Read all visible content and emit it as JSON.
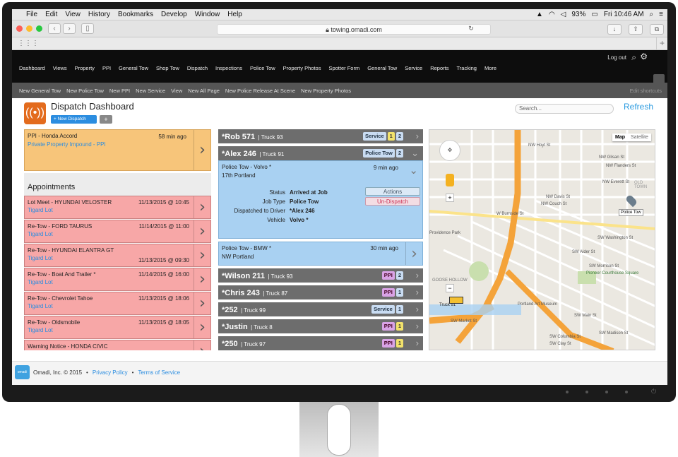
{
  "menubar": {
    "apple": "",
    "items": [
      "File",
      "Edit",
      "View",
      "History",
      "Bookmarks",
      "Develop",
      "Window",
      "Help"
    ],
    "battery": "93%",
    "clock": "Fri 10:46 AM"
  },
  "browser": {
    "url": "towing.omadi.com"
  },
  "topnav": {
    "logout": "Log out",
    "items": [
      "Dashboard",
      "Views",
      "Property",
      "PPI",
      "General Tow",
      "Shop Tow",
      "Dispatch",
      "Inspections",
      "Police Tow",
      "Property Photos",
      "Spotter Form",
      "General Tow",
      "Service",
      "Reports",
      "Tracking",
      "More"
    ]
  },
  "subnav": {
    "items": [
      "New General Tow",
      "New Police Tow",
      "New PPI",
      "New Service",
      "View",
      "New All Page",
      "New Police Release At Scene",
      "New Property Photos"
    ],
    "edit": "Edit shortcuts"
  },
  "header": {
    "title": "Dispatch Dashboard",
    "new_dispatch": "+ New Dispatch",
    "plus": "+",
    "search_placeholder": "Search...",
    "refresh": "Refresh"
  },
  "ppi_card": {
    "title": "PPI - Honda Accord",
    "time": "58 min ago",
    "subtitle": "Private Property Impound - PPI"
  },
  "appointments": {
    "heading": "Appointments",
    "items": [
      {
        "title": "Lot Meet - HYUNDAI VELOSTER",
        "date": "11/13/2015 @ 10:45",
        "location": "Tigard Lot"
      },
      {
        "title": "Re-Tow - FORD TAURUS",
        "date": "11/14/2015 @ 11:00",
        "location": "Tigard Lot"
      },
      {
        "title": "Re-Tow - HYUNDAI ELANTRA GT",
        "date": "11/13/2015 @ 09:30",
        "location": "Tigard Lot"
      },
      {
        "title": "Re-Tow - Boat And Trailer *",
        "date": "11/14/2015 @ 16:00",
        "location": "Tigard Lot"
      },
      {
        "title": "Re-Tow - Chevrolet Tahoe",
        "date": "11/13/2015 @ 18:06",
        "location": "Tigard Lot"
      },
      {
        "title": "Re-Tow - Oldsmobile",
        "date": "11/13/2015 @ 18:05",
        "location": "Tigard Lot"
      },
      {
        "title": "Warning Notice - HONDA CIVIC",
        "date": "",
        "location": ""
      }
    ]
  },
  "drivers": [
    {
      "name": "*Rob 571",
      "truck": "| Truck 93",
      "tag": "Service",
      "counts": [
        "1",
        "2"
      ]
    },
    {
      "name": "*Alex 246",
      "truck": "| Truck 91",
      "tag": "Police Tow",
      "counts": [
        "2"
      ]
    },
    {
      "name": "*Wilson 211",
      "truck": "| Truck 93",
      "tag": "PPI",
      "counts": [
        "2"
      ]
    },
    {
      "name": "*Chris 243",
      "truck": "| Truck 87",
      "tag": "PPI",
      "counts": [
        "1"
      ]
    },
    {
      "name": "*252",
      "truck": "| Truck 99",
      "tag": "Service",
      "counts": [
        "1"
      ]
    },
    {
      "name": "*Justin",
      "truck": "| Truck 8",
      "tag": "PPI",
      "counts": [
        "1"
      ]
    },
    {
      "name": "*250",
      "truck": "| Truck 97",
      "tag": "PPI",
      "counts": [
        "1"
      ]
    }
  ],
  "job1": {
    "title": "Police Tow - Volvo *",
    "address": "17th Portland",
    "time": "9 min ago",
    "details": [
      {
        "k": "Status",
        "v": "Arrived at Job"
      },
      {
        "k": "Job Type",
        "v": "Police Tow"
      },
      {
        "k": "Dispatched to Driver",
        "v": "*Alex 246"
      },
      {
        "k": "Vehicle",
        "v": "Volvo *"
      }
    ],
    "actions": "Actions",
    "undispatch": "Un-Dispatch"
  },
  "job2": {
    "title": "Police Tow - BMW *",
    "address": "NW Portland",
    "time": "30 min ago"
  },
  "map": {
    "map_btn": "Map",
    "satellite_btn": "Satellite",
    "marker_label": "Police Tow",
    "truck_label": "Truck 91",
    "streets": [
      "NW Hoyt St",
      "NW Glisan St",
      "NW Flanders St",
      "NW Everett St",
      "NW Davis St",
      "NW Couch St",
      "W Burnside St",
      "SW Washington St",
      "SW Alder St",
      "SW Morrison St",
      "SW Main St",
      "SW Madison St",
      "SW Columbia St",
      "SW Market St",
      "SW Clay St",
      "Providence Park",
      "Portland Art Museum",
      "Pioneer Courthouse Square",
      "GOOSE HOLLOW",
      "OLD TOWN"
    ]
  },
  "footer": {
    "copyright": "Omadi, Inc. © 2015",
    "sep": "•",
    "privacy": "Privacy Policy",
    "terms": "Terms of Service",
    "logo": "omadi"
  }
}
